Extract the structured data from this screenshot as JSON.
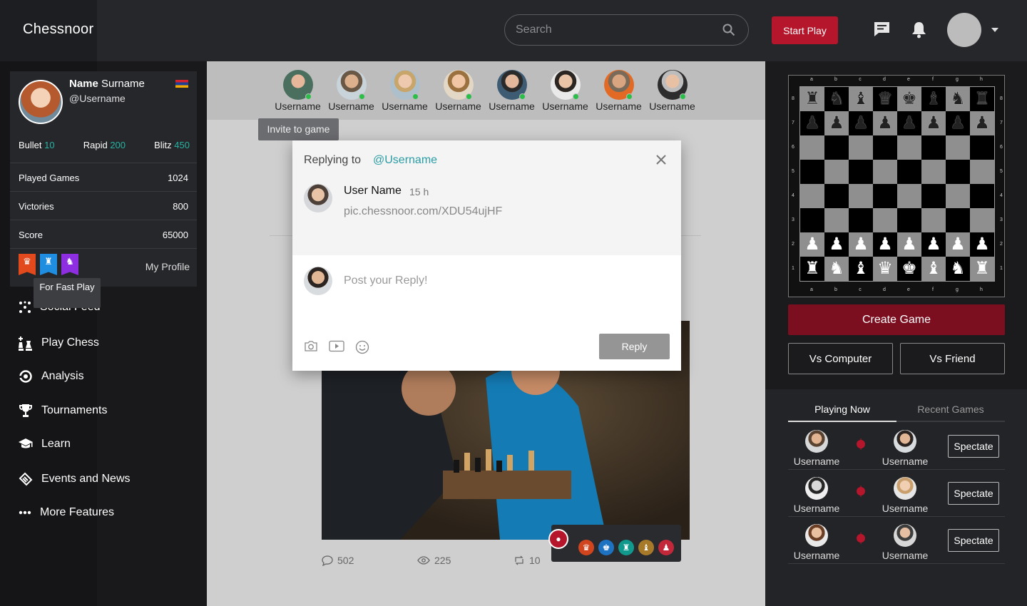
{
  "app": {
    "brand": "Chessnoor"
  },
  "header": {
    "search_placeholder": "Search",
    "start_play": "Start Play",
    "icons": [
      "chat-icon",
      "bell-icon",
      "avatar",
      "chevron-down-icon"
    ]
  },
  "profile": {
    "first": "Name",
    "last": "Surname",
    "username": "@Username",
    "ratings": [
      {
        "label": "Bullet",
        "value": "10"
      },
      {
        "label": "Rapid",
        "value": "200"
      },
      {
        "label": "Blitz",
        "value": "450"
      }
    ],
    "stats": [
      {
        "label": "Played Games",
        "value": "1024"
      },
      {
        "label": "Victories",
        "value": "800"
      },
      {
        "label": "Score",
        "value": "65000"
      }
    ],
    "my_profile": "My Profile",
    "badge_tooltip": "For Fast Play"
  },
  "nav": [
    {
      "label": "Social Feed",
      "icon": "social-feed-icon"
    },
    {
      "label": "Play Chess",
      "icon": "chess-pieces-icon"
    },
    {
      "label": "Analysis",
      "icon": "analysis-icon"
    },
    {
      "label": "Tournaments",
      "icon": "trophy-icon"
    },
    {
      "label": "Learn",
      "icon": "graduation-cap-icon"
    },
    {
      "label": "Events and News",
      "icon": "ticket-icon"
    },
    {
      "label": "More Features",
      "icon": "more-dots-icon"
    }
  ],
  "stories": {
    "names": [
      "Username",
      "Username",
      "Username",
      "Username",
      "Username",
      "Username",
      "Username",
      "Username"
    ],
    "invite_tooltip": "Invite to game"
  },
  "post": {
    "comments": "502",
    "views": "225",
    "reposts": "10"
  },
  "modal": {
    "title": "Replying to",
    "reply_to": "@Username",
    "author": "User Name",
    "time": "15 h",
    "link": "pic.chessnoor.com/XDU54ujHF",
    "reply_placeholder": "Post your Reply!",
    "reply_button": "Reply"
  },
  "board": {
    "files": [
      "a",
      "b",
      "c",
      "d",
      "e",
      "f",
      "g",
      "h"
    ],
    "ranks": [
      "8",
      "7",
      "6",
      "5",
      "4",
      "3",
      "2",
      "1"
    ]
  },
  "actions": {
    "create_game": "Create Game",
    "vs_computer": "Vs Computer",
    "vs_friend": "Vs Friend"
  },
  "games": {
    "tabs": [
      "Playing Now",
      "Recent Games"
    ],
    "rows": [
      {
        "p1": "Username",
        "p2": "Username",
        "action": "Spectate"
      },
      {
        "p1": "Username",
        "p2": "Username",
        "action": "Spectate"
      },
      {
        "p1": "Username",
        "p2": "Username",
        "action": "Spectate"
      }
    ]
  },
  "colors": {
    "accent_red": "#b5162b",
    "teal": "#27b3a2",
    "link": "#2a9ca4"
  }
}
